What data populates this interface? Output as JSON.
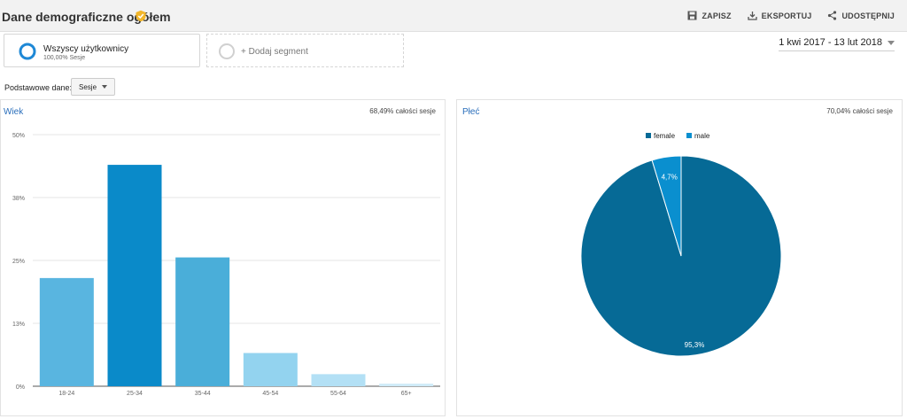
{
  "header": {
    "title": "Dane demograficzne ogółem",
    "actions": {
      "save": "ZAPISZ",
      "export": "EKSPORTUJ",
      "share": "UDOSTĘPNIJ"
    }
  },
  "segments": {
    "active": {
      "name": "Wszyscy użytkownicy",
      "share": "100,00% Sesje"
    },
    "add_label": "+ Dodaj segment"
  },
  "date_range": "1 kwi 2017 - 13 lut 2018",
  "primary_dimension": {
    "label": "Podstawowe dane:",
    "selected": "Sesje"
  },
  "colors": {
    "accent_title": "#2a6ebb",
    "female": "#066a96",
    "male": "#0a8fcf",
    "verified_badge": "#f2b62b"
  },
  "age_panel": {
    "title": "Wiek",
    "meta": "68,49% całości sesje"
  },
  "gender_panel": {
    "title": "Płeć",
    "meta": "70,04% całości sesje"
  },
  "chart_data": [
    {
      "type": "bar",
      "categories": [
        "18-24",
        "25-34",
        "35-44",
        "45-54",
        "55-64",
        "65+"
      ],
      "values": [
        21.5,
        44.0,
        25.6,
        6.6,
        2.4,
        0.5
      ],
      "ytick_labels": [
        "50%",
        "38%",
        "25%",
        "13%",
        "0%"
      ],
      "ylim": [
        0,
        50
      ],
      "grid": true,
      "bar_colors": [
        "#59b5e0",
        "#0a8ac9",
        "#4aaed9",
        "#93d3ef",
        "#b3e0f5",
        "#cfebf8"
      ]
    },
    {
      "type": "pie",
      "slices": [
        {
          "label": "female",
          "value": 95.3,
          "display": "95,3%",
          "color": "#066a96"
        },
        {
          "label": "male",
          "value": 4.7,
          "display": "4,7%",
          "color": "#0a8fcf"
        }
      ],
      "legend_position": "top-center"
    }
  ]
}
